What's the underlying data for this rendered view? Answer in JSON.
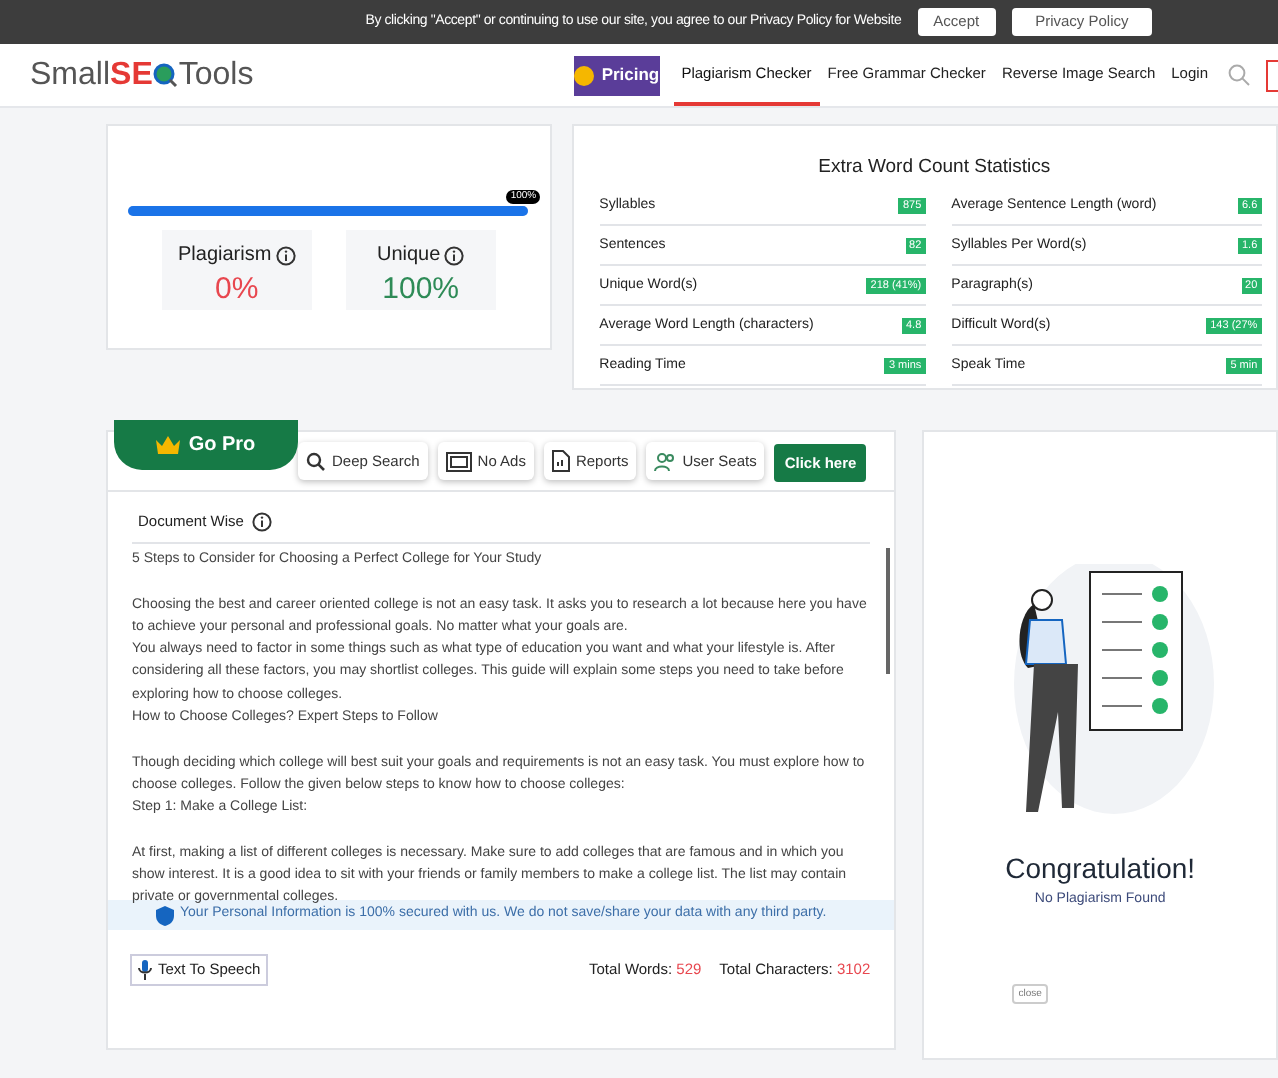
{
  "cookie_bar": {
    "message": "By clicking \"Accept\" or continuing to use our site, you agree to our Privacy Policy for Website",
    "buttons": [
      "Accept",
      "Privacy Policy"
    ]
  },
  "header": {
    "logo": {
      "left": "Small",
      "accent": "SE",
      "right": "Tools"
    },
    "pricing": "Pricing",
    "nav": [
      {
        "label": "Plagiarism Checker",
        "selected": true
      },
      {
        "label": "Free Grammar Checker",
        "selected": false
      },
      {
        "label": "Reverse Image Search",
        "selected": false
      },
      {
        "label": "Login",
        "selected": false
      }
    ]
  },
  "result": {
    "level": 1.0,
    "bubble": "100%",
    "cards": [
      {
        "label": "Plagiarism",
        "value": "0%",
        "color": "#e8474f"
      },
      {
        "label": "Unique",
        "value": "100%",
        "color": "#2e8b57"
      }
    ]
  },
  "stats": {
    "title": "Extra Word Count Statistics",
    "items": [
      {
        "label": "Syllables",
        "value": "875"
      },
      {
        "label": "Average Sentence Length (word)",
        "value": "6.6"
      },
      {
        "label": "Sentences",
        "value": "82"
      },
      {
        "label": "Syllables Per Word(s)",
        "value": "1.6"
      },
      {
        "label": "Unique Word(s)",
        "value": "218 (41%)"
      },
      {
        "label": "Paragraph(s)",
        "value": "20"
      },
      {
        "label": "Average Word Length (characters)",
        "value": "4.8"
      },
      {
        "label": "Difficult Word(s)",
        "value": "143 (27%"
      },
      {
        "label": "Reading Time",
        "value": "3 mins"
      },
      {
        "label": "Speak Time",
        "value": "5 min"
      }
    ]
  },
  "pro": {
    "tab": "Go Pro",
    "features": [
      {
        "label": "Deep Search",
        "kind": "search"
      },
      {
        "label": "No Ads",
        "kind": "ads"
      },
      {
        "label": "Reports",
        "kind": "report"
      },
      {
        "label": "User Seats",
        "kind": "users"
      }
    ],
    "cta": "Click here"
  },
  "document": {
    "heading": "Document Wise",
    "blocks": [
      [
        "5 Steps to Consider for Choosing a Perfect College for Your Study"
      ],
      [
        "Choosing the best and career oriented college is not an easy task. It asks you to research a lot because here you have to achieve your personal and professional goals. No matter what your goals are.",
        "You always need to factor in some things such as what type of education you want and what your lifestyle is. After considering all these factors, you may shortlist colleges. This guide will explain some steps you need to take before exploring how to choose colleges.",
        "How to Choose Colleges? Expert Steps to Follow"
      ],
      [
        "Though deciding which college will best suit your goals and requirements is not an easy task. You must explore how to choose colleges. Follow the given below steps to know how to choose colleges:",
        "Step 1: Make a College List:"
      ],
      [
        "At first, making a list of different colleges is necessary. Make sure to add colleges that are famous and in which you show interest. It is a good idea to sit with your friends or family members to make a college list. The list may contain private or governmental colleges."
      ]
    ],
    "privacy": "Your Personal Information is 100% secured with us. We do not save/share your data with any third party.",
    "tts": "Text To Speech",
    "totals": [
      {
        "label": "Total Words:",
        "value": "529"
      },
      {
        "label": "Total Characters:",
        "value": "3102"
      }
    ]
  },
  "congrats": {
    "title": "Congratulation!",
    "subtitle": "No Plagiarism Found",
    "close": "close"
  }
}
